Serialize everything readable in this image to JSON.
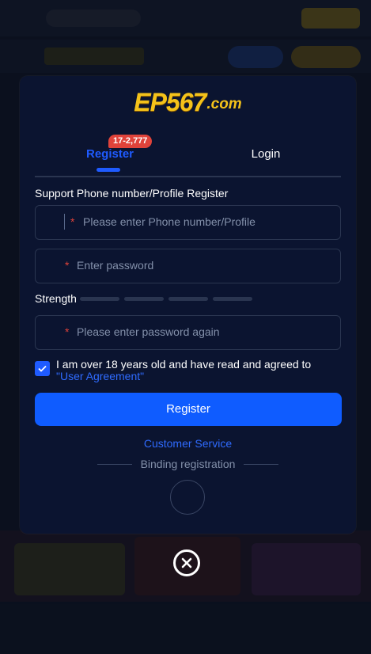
{
  "logo": {
    "main": "EP567",
    "suffix": ".com"
  },
  "tabs": {
    "register": {
      "label": "Register",
      "badge": "17-2,777"
    },
    "login": {
      "label": "Login"
    }
  },
  "form": {
    "section_title": "Support Phone number/Profile Register",
    "phone": {
      "required_mark": "*",
      "placeholder": "Please enter Phone number/Profile",
      "value": ""
    },
    "password": {
      "required_mark": "*",
      "placeholder": "Enter password",
      "value": ""
    },
    "strength_label": "Strength",
    "password_confirm": {
      "required_mark": "*",
      "placeholder": "Please enter password again",
      "value": ""
    },
    "agreement": {
      "checked": true,
      "text": "I am over 18 years old and have read and agreed to ",
      "link": "\"User Agreement\""
    },
    "register_button": "Register",
    "customer_service": "Customer Service",
    "binding_label": "Binding registration"
  },
  "colors": {
    "accent": "#0f5cff",
    "badge": "#e0433a",
    "modal_bg": "#0b1430",
    "logo": "#f4c21a"
  },
  "icons": {
    "close": "close-icon",
    "check": "checkmark-icon"
  }
}
